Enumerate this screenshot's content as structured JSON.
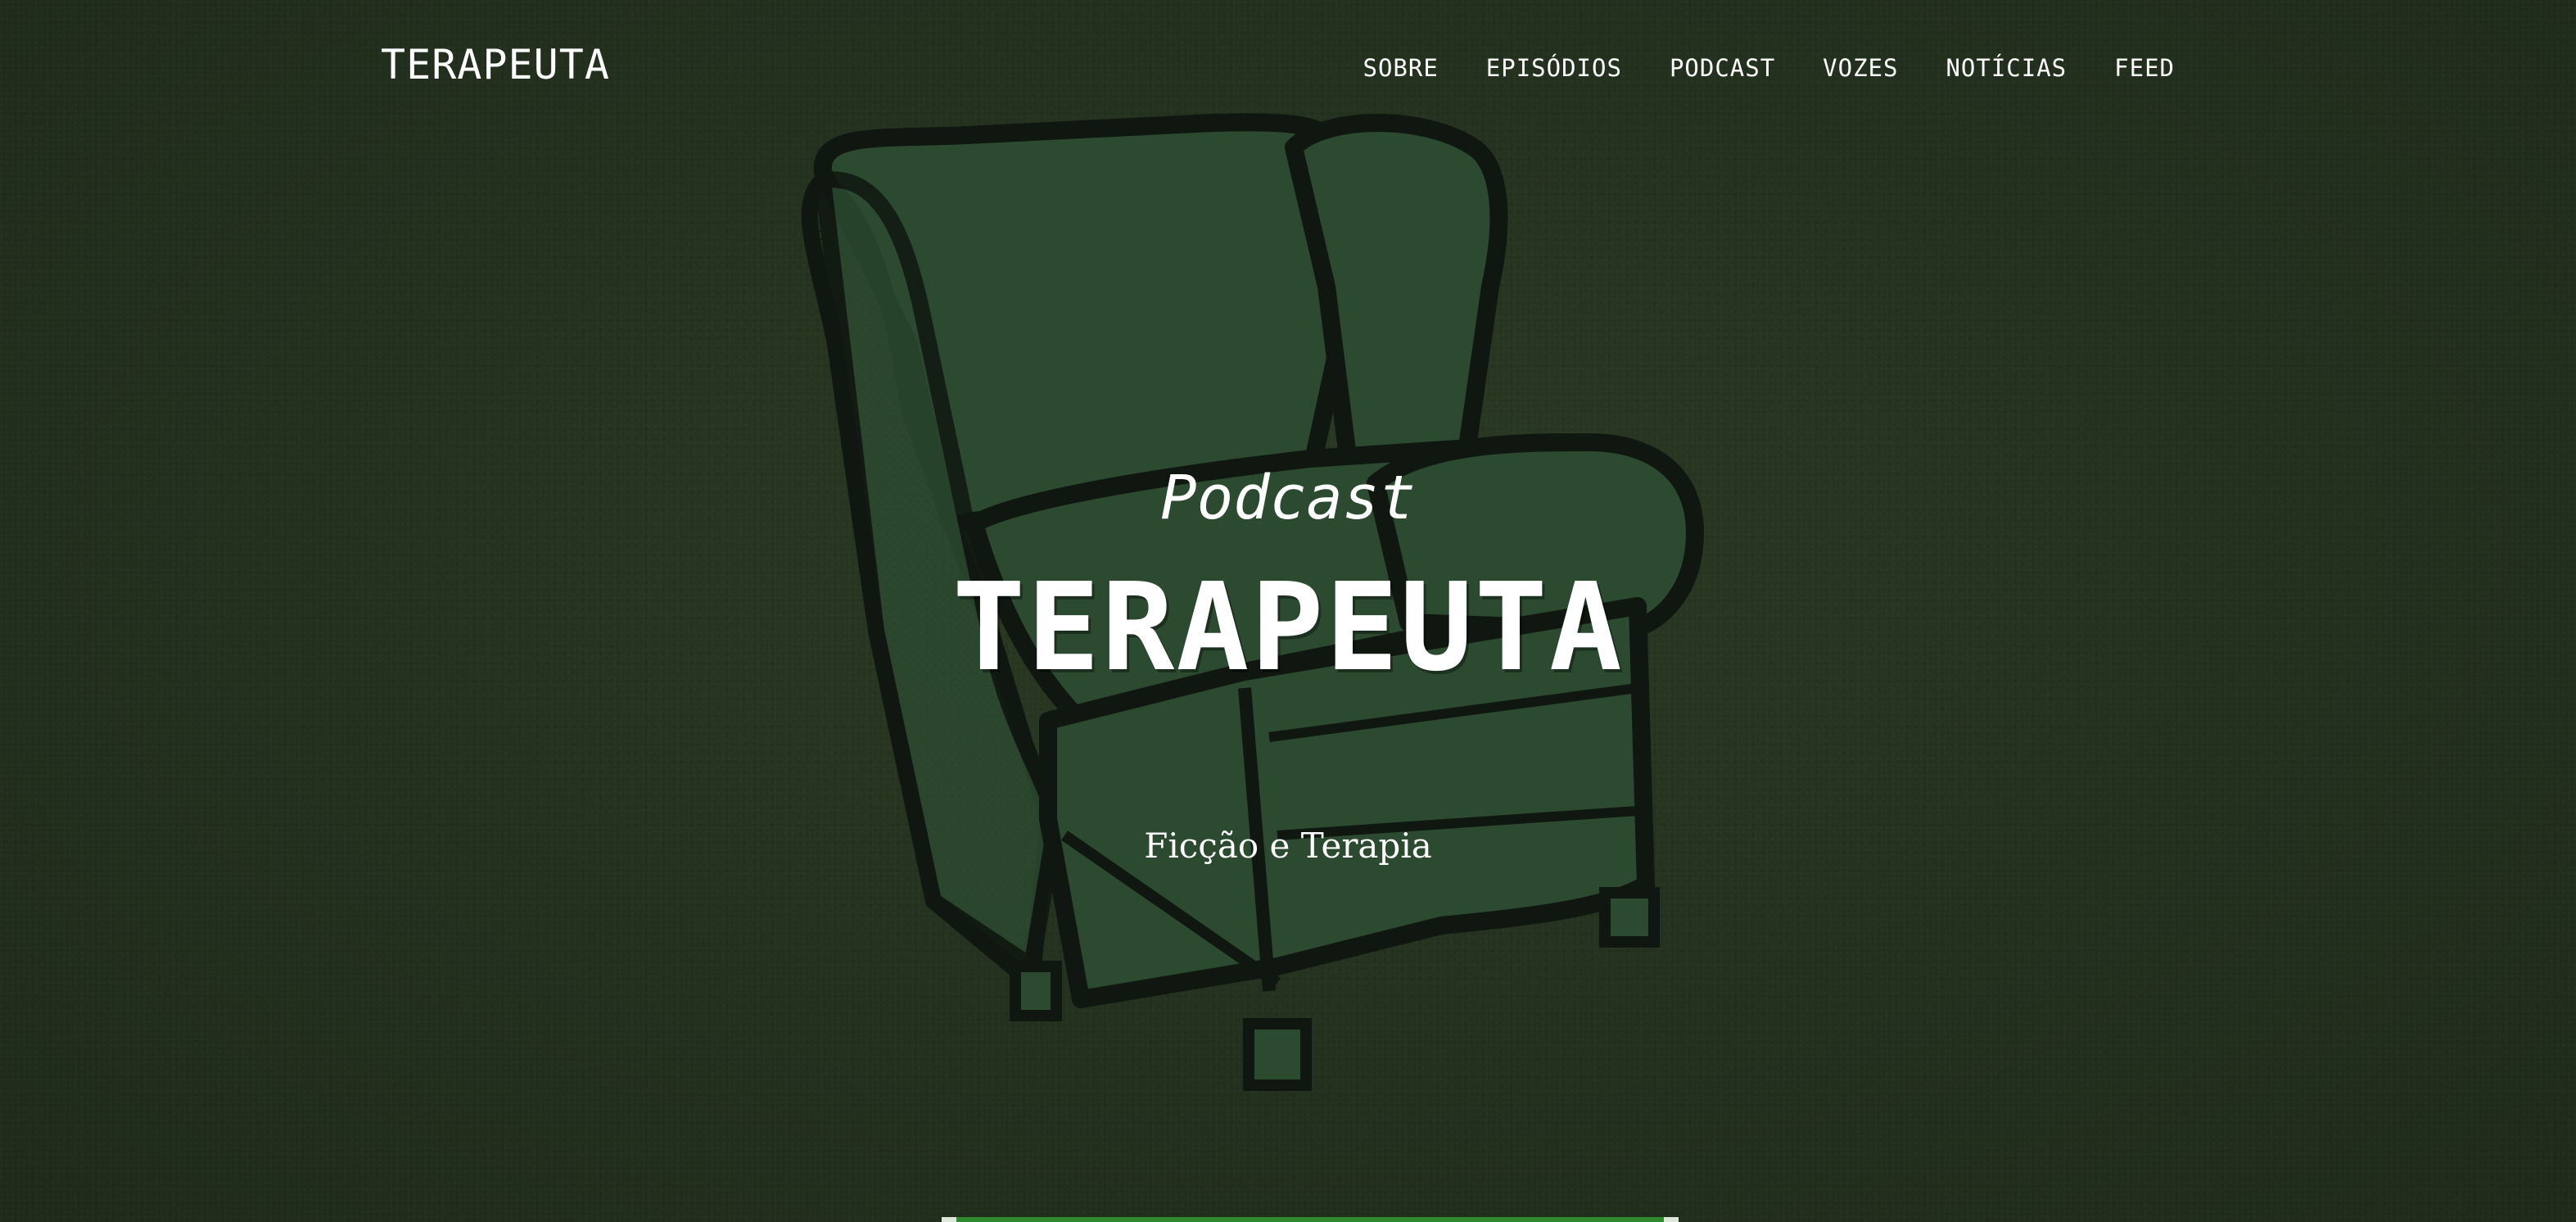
{
  "header": {
    "brand": "TERAPEUTA",
    "nav": [
      {
        "label": "SOBRE"
      },
      {
        "label": "EPISÓDIOS"
      },
      {
        "label": "PODCAST"
      },
      {
        "label": "VOZES"
      },
      {
        "label": "NOTÍCIAS"
      },
      {
        "label": "FEED"
      }
    ]
  },
  "hero": {
    "kicker": "Podcast",
    "title": "TERAPEUTA",
    "tagline": "Ficção e Terapia",
    "image": "armchair-illustration"
  },
  "colors": {
    "background": "#25321f",
    "chair_fill": "#2c4a30",
    "chair_outline": "#0f1710",
    "text": "#ffffff",
    "accent": "#2f8a2f"
  }
}
